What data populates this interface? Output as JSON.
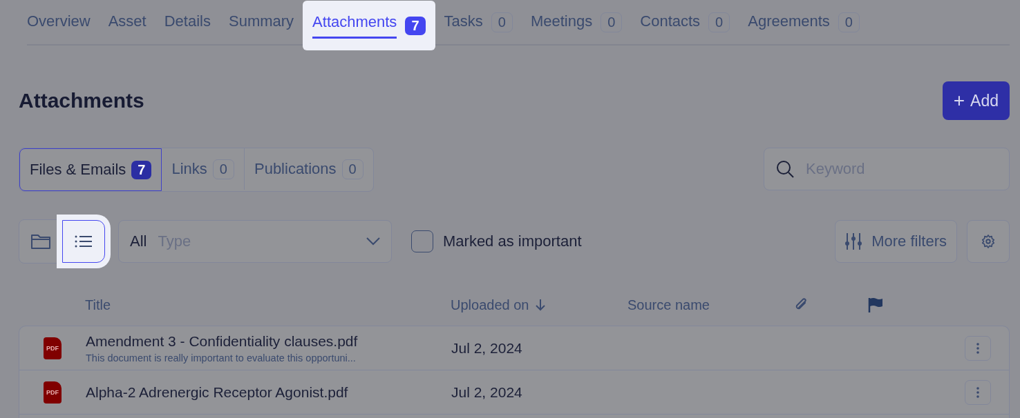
{
  "tabs": [
    {
      "label": "Overview",
      "selected": false
    },
    {
      "label": "Asset",
      "selected": false
    },
    {
      "label": "Details",
      "selected": false
    },
    {
      "label": "Summary",
      "selected": false
    },
    {
      "label": "Attachments",
      "count": "7",
      "selected": true
    },
    {
      "label": "Tasks",
      "count": "0",
      "selected": false
    },
    {
      "label": "Meetings",
      "count": "0",
      "selected": false
    },
    {
      "label": "Contacts",
      "count": "0",
      "selected": false
    },
    {
      "label": "Agreements",
      "count": "0",
      "selected": false
    }
  ],
  "heading": "Attachments",
  "add_button": {
    "icon": "+",
    "label": "Add"
  },
  "segments": [
    {
      "label": "Files & Emails",
      "count": "7",
      "selected": true
    },
    {
      "label": "Links",
      "count": "0",
      "selected": false
    },
    {
      "label": "Publications",
      "count": "0",
      "selected": false
    }
  ],
  "search": {
    "placeholder": "Keyword"
  },
  "view_modes": [
    {
      "kind": "folder",
      "selected": false
    },
    {
      "kind": "list",
      "selected": true
    }
  ],
  "type_filter": {
    "value": "All",
    "placeholder": "Type"
  },
  "important_filter": {
    "label": "Marked as important",
    "checked": false
  },
  "more_filters": {
    "label": "More filters"
  },
  "table": {
    "columns": [
      {
        "kind": "text",
        "label": "Title"
      },
      {
        "kind": "sorted",
        "label": "Uploaded on"
      },
      {
        "kind": "text",
        "label": "Source name"
      },
      {
        "kind": "clip"
      },
      {
        "kind": "flag"
      }
    ],
    "rows": [
      {
        "file_type": "PDF",
        "title": "Amendment 3 - Confidentiality clauses.pdf",
        "note": "This document is really important to evaluate this opportuni...",
        "uploaded": "Jul 2, 2024"
      },
      {
        "file_type": "PDF",
        "title": "Alpha-2 Adrenergic Receptor Agonist.pdf",
        "uploaded": "Jul 2, 2024"
      }
    ]
  }
}
